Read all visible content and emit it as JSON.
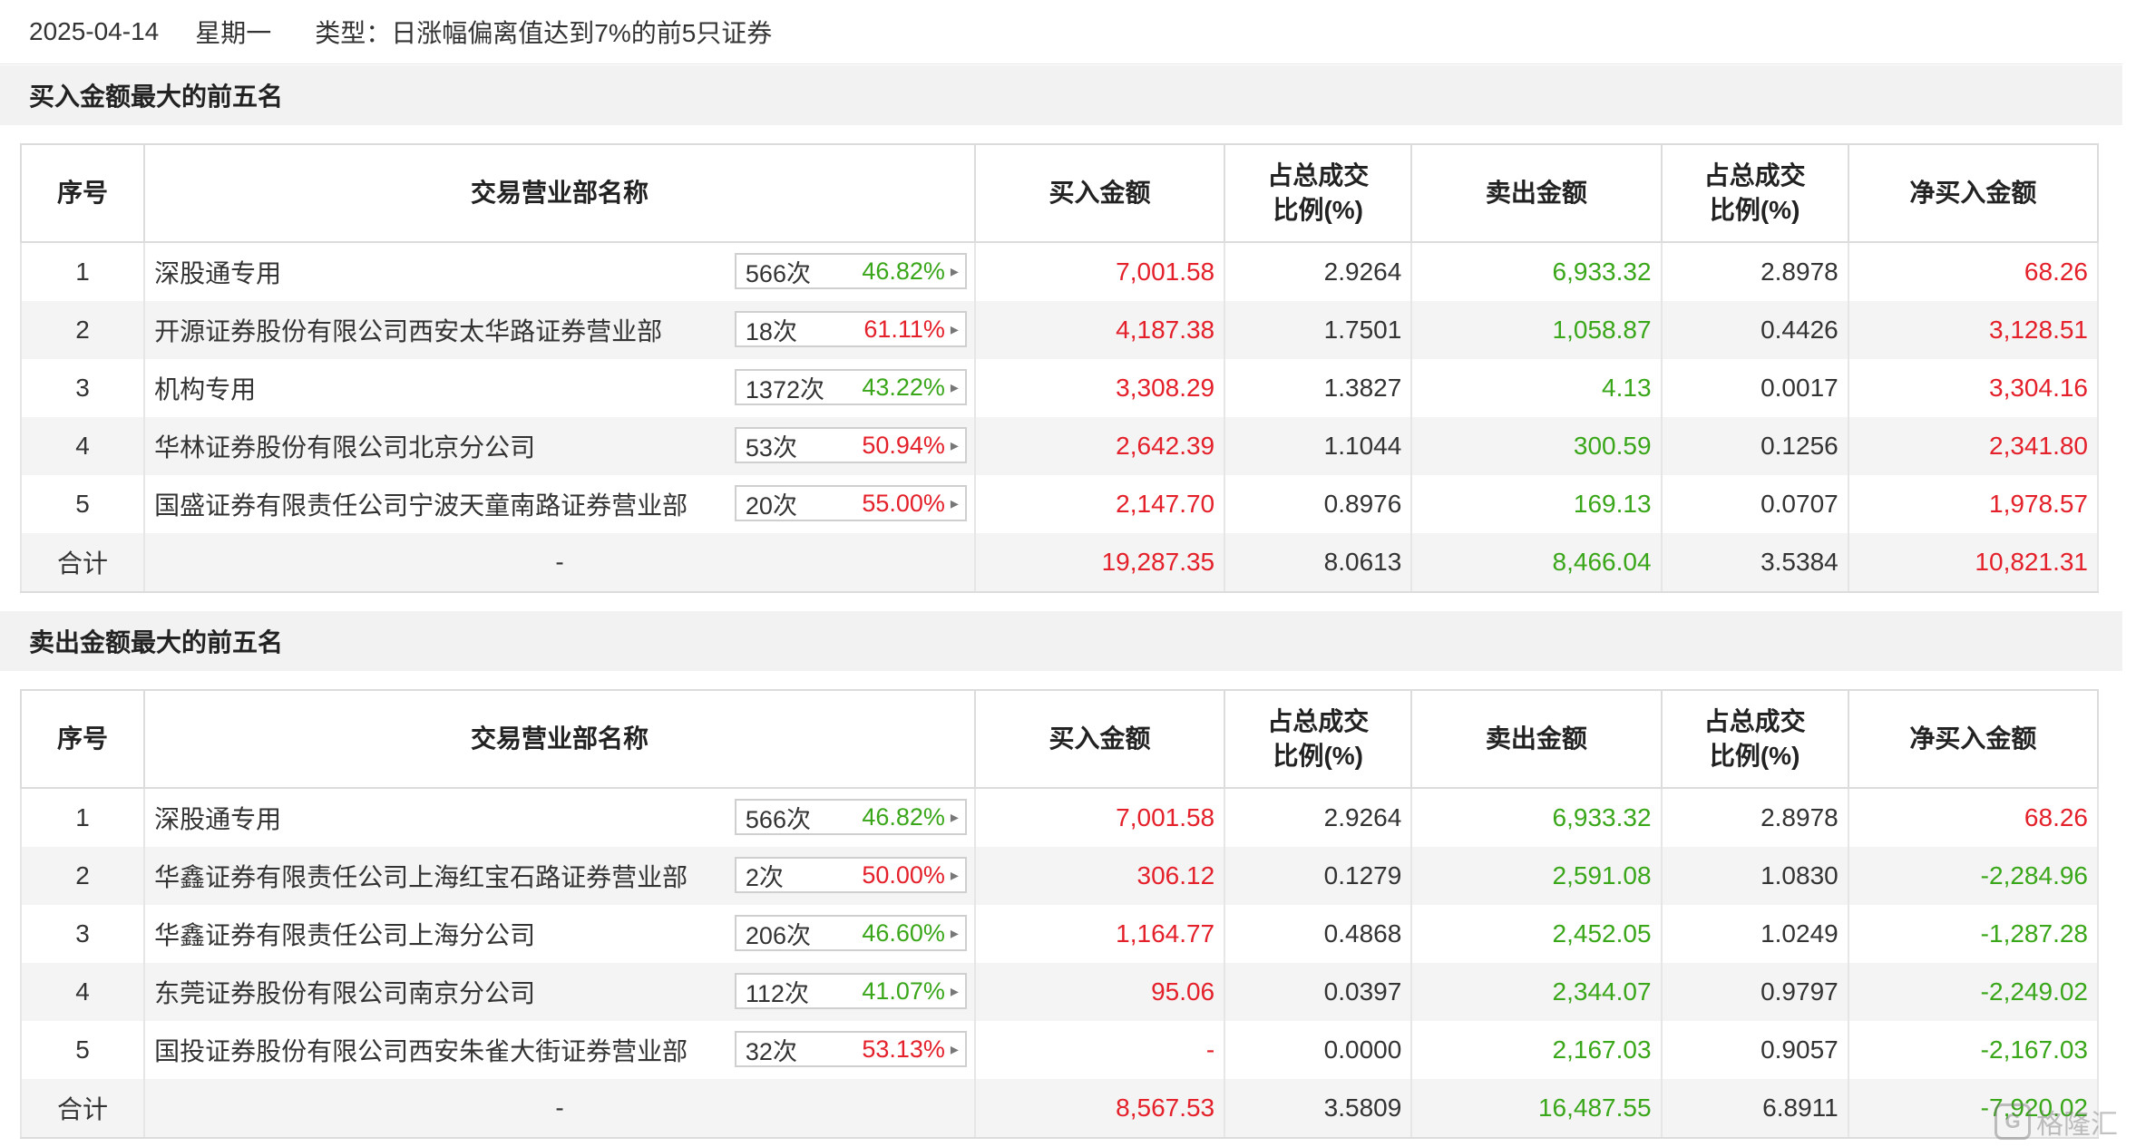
{
  "header": {
    "date": "2025-04-14",
    "weekday": "星期一",
    "type": "类型：日涨幅偏离值达到7%的前5只证券"
  },
  "columns": {
    "seq": "序号",
    "name": "交易营业部名称",
    "buy": "买入金额",
    "buy_ratio": "占总成交比例(%)",
    "sell": "卖出金额",
    "sell_ratio": "占总成交比例(%)",
    "net": "净买入金额"
  },
  "colors": {
    "up": "#e4202a",
    "down": "#3aa61a"
  },
  "buy_section": {
    "title": "买入金额最大的前五名",
    "rows": [
      {
        "seq": "1",
        "name": "深股通专用",
        "count": "566次",
        "pct": "46.82%",
        "pct_color": "green",
        "buy": "7,001.58",
        "buy_ratio": "2.9264",
        "sell": "6,933.32",
        "sell_ratio": "2.8978",
        "net": "68.26",
        "net_color": "red"
      },
      {
        "seq": "2",
        "name": "开源证券股份有限公司西安太华路证券营业部",
        "count": "18次",
        "pct": "61.11%",
        "pct_color": "red",
        "buy": "4,187.38",
        "buy_ratio": "1.7501",
        "sell": "1,058.87",
        "sell_ratio": "0.4426",
        "net": "3,128.51",
        "net_color": "red"
      },
      {
        "seq": "3",
        "name": "机构专用",
        "count": "1372次",
        "pct": "43.22%",
        "pct_color": "green",
        "buy": "3,308.29",
        "buy_ratio": "1.3827",
        "sell": "4.13",
        "sell_ratio": "0.0017",
        "net": "3,304.16",
        "net_color": "red"
      },
      {
        "seq": "4",
        "name": "华林证券股份有限公司北京分公司",
        "count": "53次",
        "pct": "50.94%",
        "pct_color": "red",
        "buy": "2,642.39",
        "buy_ratio": "1.1044",
        "sell": "300.59",
        "sell_ratio": "0.1256",
        "net": "2,341.80",
        "net_color": "red"
      },
      {
        "seq": "5",
        "name": "国盛证券有限责任公司宁波天童南路证券营业部",
        "count": "20次",
        "pct": "55.00%",
        "pct_color": "red",
        "buy": "2,147.70",
        "buy_ratio": "0.8976",
        "sell": "169.13",
        "sell_ratio": "0.0707",
        "net": "1,978.57",
        "net_color": "red"
      }
    ],
    "total": {
      "label": "合计",
      "name": "-",
      "buy": "19,287.35",
      "buy_ratio": "8.0613",
      "sell": "8,466.04",
      "sell_ratio": "3.5384",
      "net": "10,821.31",
      "net_color": "red"
    }
  },
  "sell_section": {
    "title": "卖出金额最大的前五名",
    "rows": [
      {
        "seq": "1",
        "name": "深股通专用",
        "count": "566次",
        "pct": "46.82%",
        "pct_color": "green",
        "buy": "7,001.58",
        "buy_ratio": "2.9264",
        "sell": "6,933.32",
        "sell_ratio": "2.8978",
        "net": "68.26",
        "net_color": "red"
      },
      {
        "seq": "2",
        "name": "华鑫证券有限责任公司上海红宝石路证券营业部",
        "count": "2次",
        "pct": "50.00%",
        "pct_color": "red",
        "buy": "306.12",
        "buy_ratio": "0.1279",
        "sell": "2,591.08",
        "sell_ratio": "1.0830",
        "net": "-2,284.96",
        "net_color": "green"
      },
      {
        "seq": "3",
        "name": "华鑫证券有限责任公司上海分公司",
        "count": "206次",
        "pct": "46.60%",
        "pct_color": "green",
        "buy": "1,164.77",
        "buy_ratio": "0.4868",
        "sell": "2,452.05",
        "sell_ratio": "1.0249",
        "net": "-1,287.28",
        "net_color": "green"
      },
      {
        "seq": "4",
        "name": "东莞证券股份有限公司南京分公司",
        "count": "112次",
        "pct": "41.07%",
        "pct_color": "green",
        "buy": "95.06",
        "buy_ratio": "0.0397",
        "sell": "2,344.07",
        "sell_ratio": "0.9797",
        "net": "-2,249.02",
        "net_color": "green"
      },
      {
        "seq": "5",
        "name": "国投证券股份有限公司西安朱雀大街证券营业部",
        "count": "32次",
        "pct": "53.13%",
        "pct_color": "red",
        "buy": "-",
        "buy_ratio": "0.0000",
        "sell": "2,167.03",
        "sell_ratio": "0.9057",
        "net": "-2,167.03",
        "net_color": "green"
      }
    ],
    "total": {
      "label": "合计",
      "name": "-",
      "buy": "8,567.53",
      "buy_ratio": "3.5809",
      "sell": "16,487.55",
      "sell_ratio": "6.8911",
      "net": "-7,920.02",
      "net_color": "green"
    }
  },
  "watermark": {
    "text": "格隆汇"
  }
}
